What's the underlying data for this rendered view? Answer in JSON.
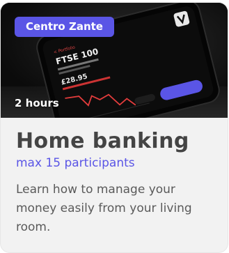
{
  "card": {
    "badge": "Centro Zante",
    "duration": "2 hours",
    "title": "Home banking",
    "subtitle": "max 15 participants",
    "description": "Learn how to manage your money easily from your living room."
  },
  "hero_image": {
    "screen_title": "FTSE 100",
    "back_label": "< Portfolio",
    "price": "£28.95"
  },
  "colors": {
    "accent": "#5a55e6",
    "title": "#444444",
    "body_text": "#5a5a5a",
    "card_bg": "#f2f2f2"
  }
}
